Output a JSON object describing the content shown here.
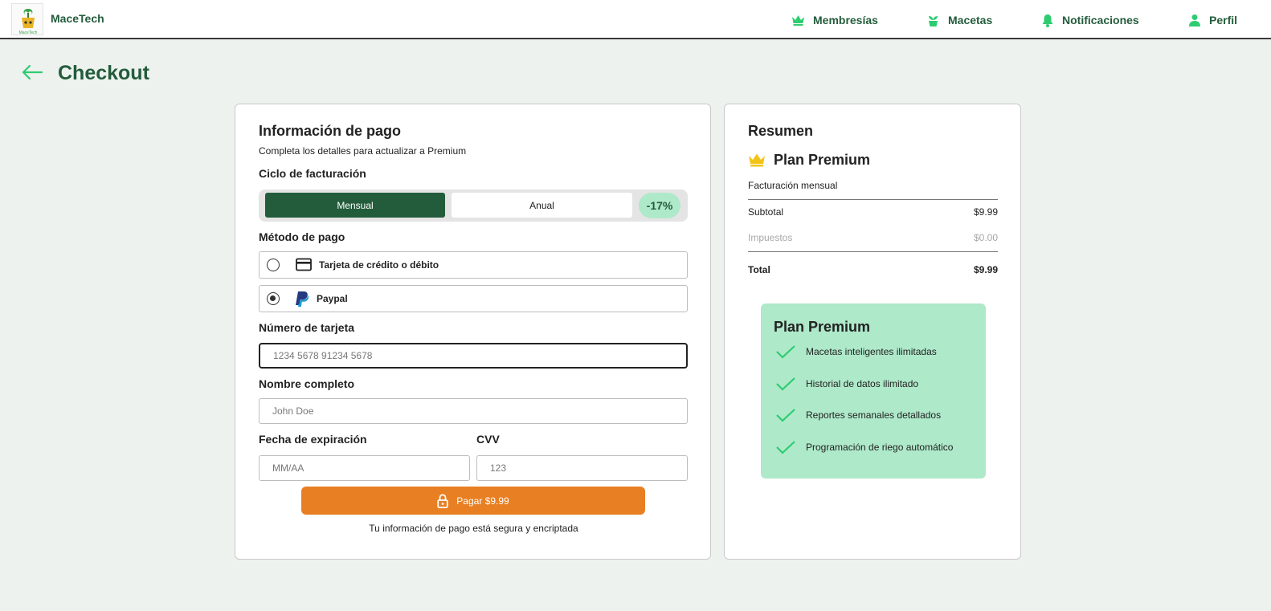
{
  "brand": {
    "name": "MaceTech",
    "logo_text": "MaceTech"
  },
  "nav": [
    {
      "label": "Membresías",
      "icon": "crown-icon"
    },
    {
      "label": "Macetas",
      "icon": "plant-pot-icon"
    },
    {
      "label": "Notificaciones",
      "icon": "bell-icon"
    },
    {
      "label": "Perfil",
      "icon": "user-icon"
    }
  ],
  "page": {
    "title": "Checkout"
  },
  "payment": {
    "title": "Información de pago",
    "subtitle": "Completa los detalles para actualizar a Premium",
    "cycle_label": "Ciclo de facturación",
    "cycle_options": [
      "Mensual",
      "Anual"
    ],
    "cycle_selected": "Mensual",
    "discount": "-17%",
    "method_label": "Método de pago",
    "methods": [
      {
        "label": "Tarjeta de crédito o débito",
        "icon": "credit-card-icon",
        "selected": false
      },
      {
        "label": "Paypal",
        "icon": "paypal-icon",
        "selected": true
      }
    ],
    "card_number_label": "Número de tarjeta",
    "card_number_placeholder": "1234 5678 91234 5678",
    "name_label": "Nombre completo",
    "name_placeholder": "John Doe",
    "expiry_label": "Fecha de expiración",
    "expiry_placeholder": "MM/AA",
    "cvv_label": "CVV",
    "cvv_placeholder": "123",
    "pay_button": "Pagar $9.99",
    "secure_note": "Tu información de pago está segura y encriptada"
  },
  "summary": {
    "title": "Resumen",
    "plan_name": "Plan Premium",
    "billing": "Facturación mensual",
    "subtotal_label": "Subtotal",
    "subtotal_value": "$9.99",
    "taxes_label": "Impuestos",
    "taxes_value": "$0.00",
    "total_label": "Total",
    "total_value": "$9.99",
    "benefits_title": "Plan Premium",
    "benefits": [
      "Macetas inteligentes ilimitadas",
      "Historial de datos ilimitado",
      "Reportes semanales detallados",
      "Programación de riego automático"
    ]
  },
  "colors": {
    "primary_green": "#235c3b",
    "accent_green": "#2ecc71",
    "benefits_bg": "#aee9c9",
    "pay_orange": "#e87f22",
    "crown_gold": "#f2c418"
  }
}
